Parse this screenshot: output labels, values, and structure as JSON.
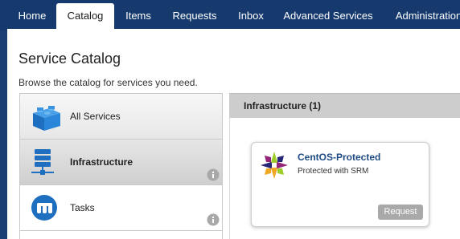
{
  "nav": {
    "tabs": [
      {
        "label": "Home",
        "active": false
      },
      {
        "label": "Catalog",
        "active": true
      },
      {
        "label": "Items",
        "active": false
      },
      {
        "label": "Requests",
        "active": false
      },
      {
        "label": "Inbox",
        "active": false
      },
      {
        "label": "Advanced Services",
        "active": false
      },
      {
        "label": "Administration",
        "active": false
      }
    ]
  },
  "page": {
    "title": "Service Catalog",
    "subtitle": "Browse the catalog for services you need."
  },
  "categories": [
    {
      "label": "All Services",
      "icon": "blocks-icon",
      "selected": false
    },
    {
      "label": "Infrastructure",
      "icon": "server-network-icon",
      "selected": true
    },
    {
      "label": "Tasks",
      "icon": "tasks-logo-icon",
      "selected": false
    }
  ],
  "content": {
    "header": "Infrastructure (1)",
    "items": [
      {
        "title": "CentOS-Protected",
        "description": "Protected with SRM",
        "icon": "centos-logo-icon",
        "request_label": "Request"
      }
    ]
  },
  "colors": {
    "nav_bg": "#163a6e",
    "link_blue": "#1d4a80",
    "request_button": "#a9a9a9",
    "header_gray": "#cdcdcd"
  }
}
